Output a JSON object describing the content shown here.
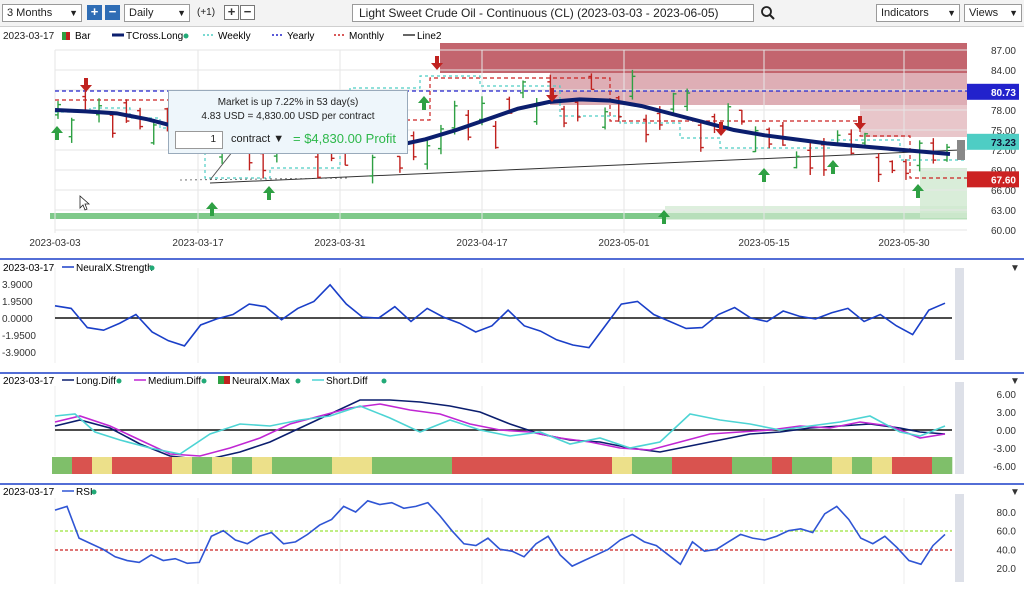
{
  "toolbar": {
    "period": "3 Months",
    "interval": "Daily",
    "offset": "(+1)",
    "title": "Light Sweet Crude Oil - Continuous (CL) (2023-03-03 - 2023-06-05)",
    "indicators_label": "Indicators",
    "views_label": "Views",
    "icons": [
      "plus-icon",
      "minus-icon",
      "search-icon",
      "chevron-down-icon"
    ]
  },
  "colors": {
    "up": "#2ea043",
    "down": "#c0221f",
    "tcross": "#0b1e6e",
    "weekly": "#4ecdc4",
    "yearly": "#2222cc",
    "monthly": "#cc2222",
    "neural": "#1a3fc8",
    "medium": "#c026d3",
    "short": "#4dd4d4",
    "rsi": "#2f55d4",
    "red_zone": "#b94a55",
    "green_zone": "#7fc98a"
  },
  "price_pane": {
    "date_label": "2023-03-17",
    "legend": [
      {
        "label": "Bar",
        "icon": "bar-icon"
      },
      {
        "label": "TCross.Long",
        "icon": "dot-icon"
      },
      {
        "label": "Weekly"
      },
      {
        "label": "Yearly"
      },
      {
        "label": "Monthly"
      },
      {
        "label": "Line2"
      }
    ],
    "y_ticks": [
      "87.00",
      "84.00",
      "81.00",
      "78.00",
      "75.00",
      "72.00",
      "69.00",
      "66.00",
      "63.00",
      "60.00"
    ],
    "x_ticks": [
      "2023-03-03",
      "2023-03-17",
      "2023-03-31",
      "2023-04-17",
      "2023-05-01",
      "2023-05-15",
      "2023-05-30"
    ],
    "price_tags": [
      {
        "value": "80.73",
        "color": "#2222cc"
      },
      {
        "value": "73.23",
        "color": "#4ecdc4"
      },
      {
        "value": "67.60",
        "color": "#cc2222"
      }
    ],
    "popup": {
      "line1": "Market is up 7.22% in 53 day(s)",
      "line2": "4.83 USD = 4,830.00 USD per contract",
      "quantity": "1",
      "unit": "contract",
      "profit": "= $4,830.00 Profit"
    }
  },
  "neural_pane": {
    "date_label": "2023-03-17",
    "legend": "NeuralX.Strength",
    "y_ticks": [
      "3.9000",
      "1.9500",
      "0.0000",
      "-1.9500",
      "-3.9000"
    ]
  },
  "diff_pane": {
    "date_label": "2023-03-17",
    "legend": [
      "Long.Diff",
      "Medium.Diff",
      "NeuralX.Max",
      "Short.Diff"
    ],
    "y_ticks": [
      "6.00",
      "3.00",
      "0.00",
      "-3.00",
      "-6.00"
    ]
  },
  "rsi_pane": {
    "date_label": "2023-03-17",
    "legend": "RSI",
    "y_ticks": [
      "80.0",
      "60.0",
      "40.0",
      "20.0"
    ]
  },
  "chart_data": {
    "type": "line",
    "title": "Light Sweet Crude Oil - Continuous (CL) (2023-03-03 - 2023-06-05)",
    "price_ylim": [
      60,
      87
    ],
    "tcross_long": [
      78.0,
      77.8,
      77.5,
      76.6,
      75.4,
      74.4,
      73.6,
      72.8,
      72.3,
      72.0,
      72.1,
      72.6,
      73.6,
      75.0,
      76.6,
      78.2,
      79.2,
      79.6,
      79.4,
      78.6,
      77.4,
      76.2,
      75.0,
      74.2,
      73.6,
      73.0,
      72.6,
      72.2,
      71.8,
      71.4
    ],
    "neural_strength": [
      1.4,
      1.1,
      -1.1,
      -1.4,
      -0.6,
      0.4,
      -1.6,
      -2.6,
      -3.2,
      -0.8,
      -0.1,
      0.4,
      1.6,
      1.3,
      -0.2,
      1.1,
      1.9,
      3.8,
      1.6,
      0.1,
      0.0,
      1.3,
      -0.4,
      1.1,
      0.1,
      -0.6,
      -1.6,
      -0.9,
      0.9,
      -0.9,
      -1.5,
      -2.5,
      -3.1,
      -3.4,
      -0.9,
      1.6,
      1.9,
      0.4,
      -0.4,
      -1.2,
      -1.1,
      0.4,
      1.2,
      0.0,
      -0.4,
      0.8,
      0.2,
      -0.1,
      0.6,
      1.1,
      -0.4,
      0.4,
      -0.9,
      -1.9,
      0.9,
      1.7
    ],
    "neuralx_max": [
      "up",
      "down",
      "neutral",
      "down",
      "down",
      "down",
      "neutral",
      "up",
      "neutral",
      "up",
      "neutral",
      "up",
      "up",
      "up",
      "neutral",
      "neutral",
      "up",
      "up",
      "up",
      "up",
      "down",
      "down",
      "down",
      "down",
      "down",
      "down",
      "down",
      "down",
      "neutral",
      "up",
      "up",
      "down",
      "down",
      "down",
      "up",
      "up",
      "down",
      "up",
      "up",
      "neutral",
      "up",
      "neutral",
      "down",
      "down",
      "up"
    ],
    "rsi": [
      82,
      86,
      52,
      46,
      40,
      32,
      28,
      26,
      34,
      28,
      30,
      25,
      26,
      54,
      60,
      50,
      46,
      54,
      58,
      46,
      48,
      56,
      66,
      72,
      86,
      80,
      92,
      88,
      90,
      84,
      86,
      90,
      76,
      60,
      46,
      44,
      52,
      40,
      38,
      32,
      46,
      54,
      34,
      22,
      28,
      34,
      40,
      50,
      56,
      48,
      44,
      34,
      24,
      48,
      38,
      40,
      48,
      56,
      52,
      50,
      54,
      60,
      62,
      58,
      78,
      86,
      72,
      52,
      46,
      54,
      42,
      28,
      24,
      44,
      56
    ]
  }
}
